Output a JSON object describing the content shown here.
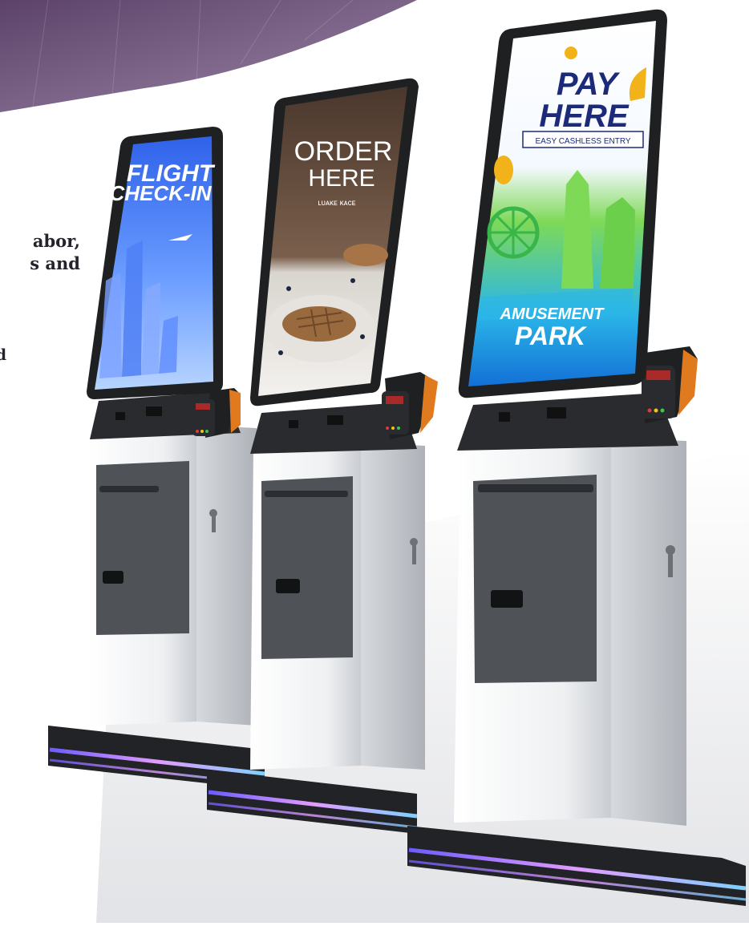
{
  "background": {
    "arc_color": "#6f547c",
    "floor_color": "#e4e5e8"
  },
  "side_copy": {
    "line1": "abor,",
    "line2": "s and",
    "line3": "d"
  },
  "kiosks": [
    {
      "name": "flight-checkin-kiosk",
      "screen_lines": [
        "FLIGHT",
        "CHECK-IN"
      ],
      "screen_colors": {
        "top": "#3b6ff2",
        "bottom": "#9fc6ff"
      }
    },
    {
      "name": "order-kiosk",
      "screen_lines": [
        "ORDER",
        "HERE"
      ],
      "screen_subtitle": "ʟᴜᴀᴋᴇ ᴋᴀᴄᴇ",
      "screen_colors": {
        "top": "#5a4538",
        "bottom": "#f1ede8"
      }
    },
    {
      "name": "pay-kiosk",
      "screen_lines": [
        "PAY",
        "HERE"
      ],
      "screen_tagline": "EASY CASHLESS ENTRY",
      "screen_footer": [
        "AMUSEMENT",
        "PARK"
      ],
      "screen_colors": {
        "top": "#ffffff",
        "bottom": "#1aa3e8"
      }
    }
  ],
  "colors": {
    "body_white": "#f4f5f7",
    "body_gray": "#55595f",
    "bezel": "#1f2022",
    "accent_orange": "#e07a1f",
    "base_glow": "#8d7cff",
    "coin_yellow": "#f2b31a",
    "navy_text": "#1c2a7a"
  }
}
